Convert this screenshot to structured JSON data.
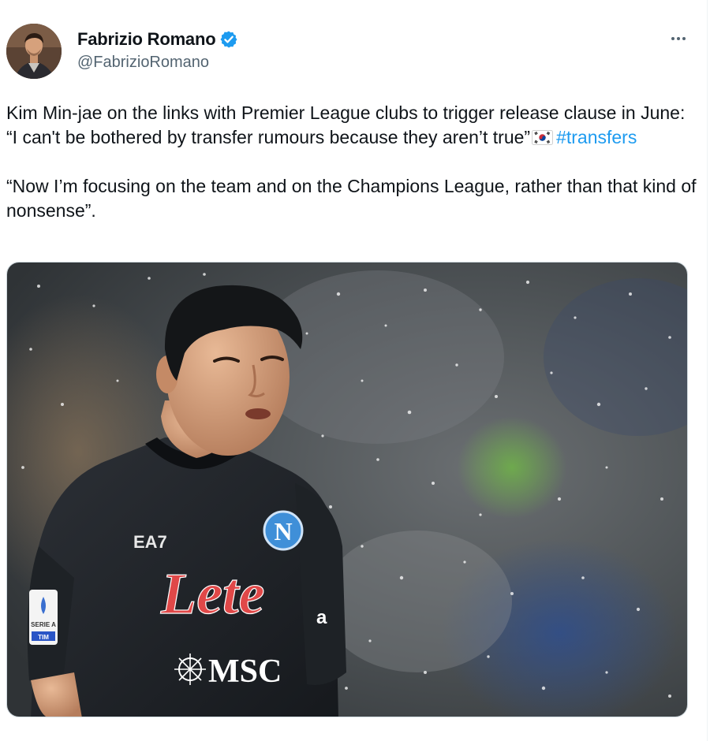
{
  "author": {
    "display_name": "Fabrizio Romano",
    "handle": "@FabrizioRomano",
    "verified": true,
    "avatar_icon": "profile-photo",
    "verified_icon": "verified-badge-icon"
  },
  "menu": {
    "more_icon": "more-options-icon"
  },
  "tweet": {
    "paragraph1_text": "Kim Min-jae on the links with Premier League clubs to trigger release clause in June: “I can't be bothered by transfer rumours because they aren’t true”",
    "flag_icon": "south-korea-flag-icon",
    "hashtag": "#transfers",
    "paragraph2_text": "“Now I’m focusing on the team and on the Champions League, rather than that kind of nonsense”."
  },
  "media": {
    "shirt_logo": "EA7",
    "sponsor": "Lete",
    "secondary_sponsor": "MSC",
    "sleeve_badge": "SERIE A",
    "sleeve_sub": "TIM",
    "side_text": "a"
  },
  "colors": {
    "link": "#1d9bf0",
    "text": "#0f1419",
    "secondary_text": "#536471",
    "verified": "#1d9bf0"
  }
}
